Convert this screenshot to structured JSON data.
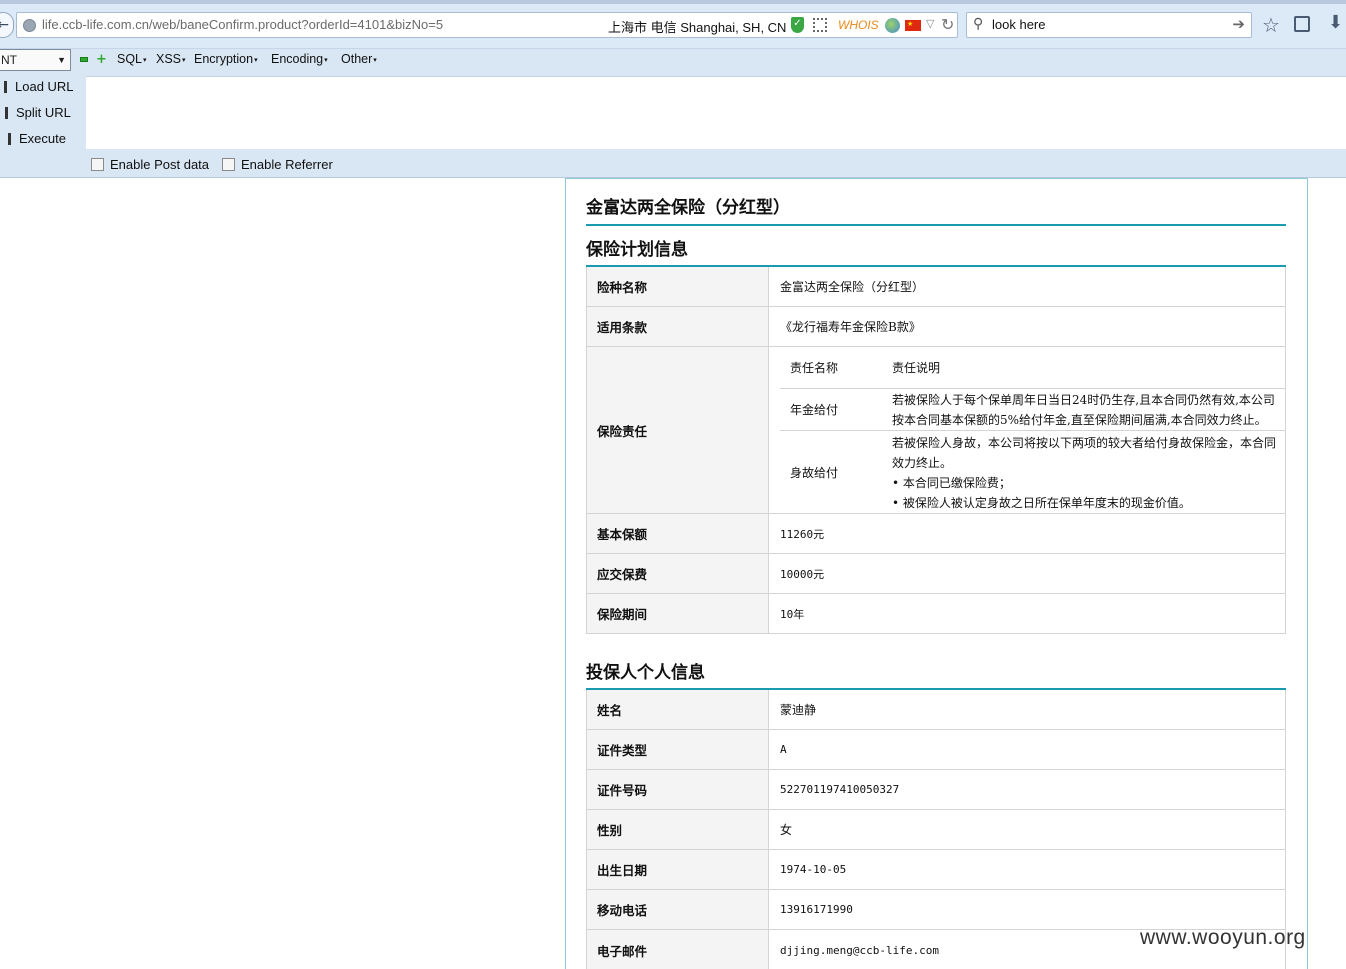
{
  "browser": {
    "url": "life.ccb-life.com.cn/web/baneConfirm.product?orderId=4101&bizNo=5",
    "geo": "上海市 电信    Shanghai, SH, CN",
    "whois": "WHOIS",
    "search_value": "look here"
  },
  "hackbar": {
    "mode": "NT",
    "menus": [
      "SQL",
      "XSS",
      "Encryption",
      "Encoding",
      "Other"
    ],
    "load_url": "Load URL",
    "split_url": "Split URL",
    "execute": "Execute",
    "post_data": "Enable Post data",
    "referrer": "Enable Referrer"
  },
  "page": {
    "product_title": "金富达两全保险（分红型）",
    "plan_section_title": "保险计划信息",
    "plan_rows": [
      {
        "label": "险种名称",
        "value": "金富达两全保险（分红型）"
      },
      {
        "label": "适用条款",
        "value": "《龙行福寿年金保险B款》"
      }
    ],
    "liability": {
      "label": "保险责任",
      "header_name": "责任名称",
      "header_desc": "责任说明",
      "items": [
        {
          "name": "年金给付",
          "lines": [
            "若被保险人于每个保单周年日当日24时仍生存,且本合同仍然有效,本公司",
            "按本合同基本保额的5%给付年金,直至保险期间届满,本合同效力终止。"
          ]
        },
        {
          "name": "身故给付",
          "lines": [
            "若被保险人身故，本公司将按以下两项的较大者给付身故保险金，本合同",
            "效力终止。",
            "• 本合同已缴保险费；",
            "• 被保险人被认定身故之日所在保单年度末的现金价值。"
          ]
        }
      ]
    },
    "plan_rows_2": [
      {
        "label": "基本保额",
        "value": "11260元"
      },
      {
        "label": "应交保费",
        "value": "10000元"
      },
      {
        "label": "保险期间",
        "value": "10年"
      }
    ],
    "holder_section_title": "投保人个人信息",
    "holder_rows": [
      {
        "label": "姓名",
        "value": "蒙迪静"
      },
      {
        "label": "证件类型",
        "value": "A"
      },
      {
        "label": "证件号码",
        "value": "522701197410050327"
      },
      {
        "label": "性别",
        "value": "女"
      },
      {
        "label": "出生日期",
        "value": "1974-10-05"
      },
      {
        "label": "移动电话",
        "value": "13916171990"
      },
      {
        "label": "电子邮件",
        "value": "djjing.meng@ccb-life.com"
      }
    ]
  },
  "watermark": "www.wooyun.org"
}
